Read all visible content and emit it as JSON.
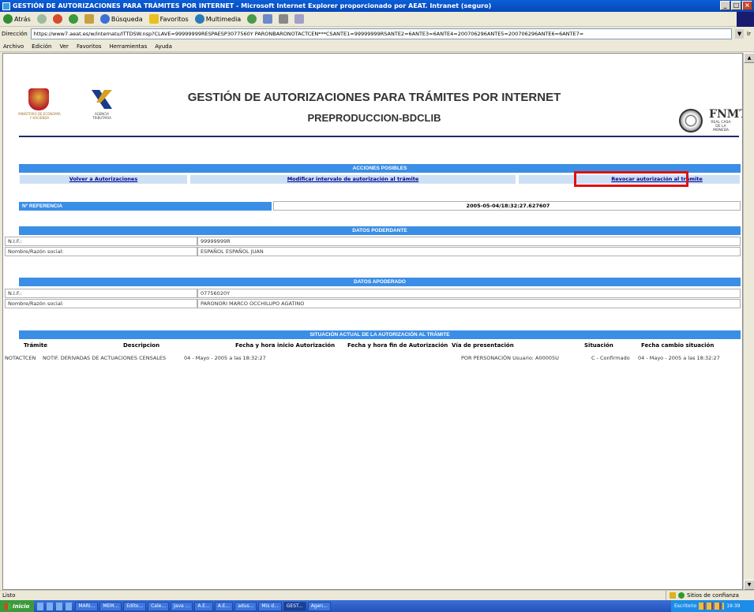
{
  "window": {
    "title": "GESTIÓN DE AUTORIZACIONES PARA TRÁMITES POR INTERNET - Microsoft Internet Explorer proporcionado por AEAT. Intranet (seguro)"
  },
  "toolbar": {
    "back": "Atrás",
    "search": "Búsqueda",
    "favorites": "Favoritos",
    "multimedia": "Multimedia"
  },
  "address": {
    "label": "Dirección",
    "url": "https://www7.aeat.es/w/internatu/ITTDSW.nsp?CLAVE=99999999RESPAESP3077560Y PARONBARONOTACTCEN***CSANTE1=99999999RSANTE2=6ANTE3=6ANTE4=200706296ANTE5=200706296ANTE6=6ANTE7=",
    "go": "Ir"
  },
  "menu": [
    "Archivo",
    "Edición",
    "Ver",
    "Favoritos",
    "Herramientas",
    "Ayuda"
  ],
  "header": {
    "ministry": "MINISTERIO DE ECONOMÍA Y HACIENDA",
    "agency": "AGENCIA TRIBUTARIA",
    "title": "GESTIÓN DE AUTORIZACIONES PARA TRÁMITES POR INTERNET",
    "subtitle": "PREPRODUCCION-BDCLIB",
    "fnmt_line1": "FNMT",
    "fnmt_line2": "REAL CASA DE LA MONEDA"
  },
  "acciones": {
    "header": "ACCIONES POSIBLES",
    "links": [
      "Volver a Autorizaciones",
      "Modificar intervalo de autorización al trámite",
      "Revocar autorización al trámite"
    ]
  },
  "referencia": {
    "label": "Nº REFERENCIA",
    "value": "2005-05-04/18:32:27.627607"
  },
  "poderdante": {
    "header": "DATOS PODERDANTE",
    "nif_label": "N.I.F.:",
    "nif_value": "99999999R",
    "nombre_label": "Nombre/Razón social:",
    "nombre_value": "ESPAÑOL ESPAÑOL JUAN"
  },
  "apoderado": {
    "header": "DATOS APODERADO",
    "nif_label": "N.I.F.:",
    "nif_value": "07756020Y",
    "nombre_label": "Nombre/Razón social:",
    "nombre_value": "PARONORI MARCO OCCHILUPO AGATINO"
  },
  "situacion": {
    "header": "SITUACIÓN ACTUAL DE LA AUTORIZACIÓN AL TRÁMITE",
    "columns": [
      "Trámite",
      "Descripcion",
      "Fecha y hora inicio Autorización",
      "Fecha y hora fin de Autorización",
      "Vía de presentación",
      "Situación",
      "Fecha cambio situación"
    ],
    "row": {
      "tramite": "NOTACTCEN",
      "descripcion": "NOTIF. DERIVADAS DE ACTUACIONES CENSALES",
      "inicio": "04 - Mayo - 2005 a las 18:32:27",
      "fin": "",
      "via": "POR PERSONACIÓN Usuario: A00005U",
      "situacion": "C - Confirmado",
      "fecha_cambio": "04 - Mayo - 2005 a las 18:32:27"
    }
  },
  "status": {
    "left": "Listo",
    "zone": "Sitios de confianza"
  },
  "taskbar": {
    "start": "Inicio",
    "tasks": [
      "MARI...",
      "MEM...",
      "Edito...",
      "Cale...",
      "Java ...",
      "A.E...",
      "A.E...",
      "adus...",
      "Mis d...",
      "GEST...",
      "Agen..."
    ],
    "tray_label": "Escritorio",
    "clock": "19:39"
  }
}
